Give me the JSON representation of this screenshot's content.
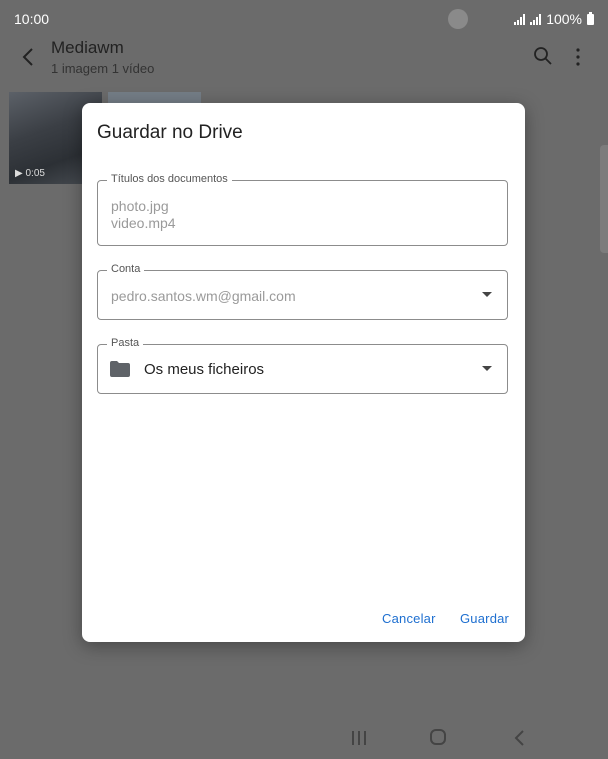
{
  "status_bar": {
    "time": "10:00",
    "battery": "100%"
  },
  "app_bar": {
    "title": "Mediawm",
    "subtitle": "1 imagem 1 vídeo"
  },
  "thumbnails": [
    {
      "duration": "0:05"
    }
  ],
  "dialog": {
    "title": "Guardar no Drive",
    "documents": {
      "label": "Títulos dos documentos",
      "items": [
        "photo.jpg",
        "video.mp4"
      ]
    },
    "account": {
      "label": "Conta",
      "value": "pedro.santos.wm@gmail.com"
    },
    "folder": {
      "label": "Pasta",
      "value": "Os meus ficheiros"
    },
    "cancel_label": "Cancelar",
    "save_label": "Guardar"
  },
  "colors": {
    "accent": "#1e6fd0",
    "scrim": "#6b6b6b"
  },
  "icons": [
    "back-arrow-icon",
    "search-icon",
    "more-vert-icon",
    "play-icon",
    "dropdown-arrow-icon",
    "folder-icon",
    "recent-apps-icon",
    "home-icon",
    "back-icon"
  ]
}
